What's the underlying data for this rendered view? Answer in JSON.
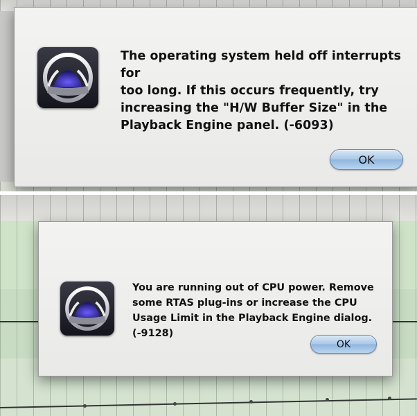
{
  "dialogs": [
    {
      "message": "The operating system held off interrupts for\ntoo long. If this occurs frequently, try\nincreasing the \"H/W Buffer Size\" in the\nPlayback Engine panel.  (-6093)",
      "ok_label": "OK",
      "icon": "app-logo-icon"
    },
    {
      "message": "You are running out of CPU power. Remove\nsome RTAS plug-ins or increase the CPU\nUsage Limit in the Playback Engine dialog.\n(-9128)",
      "ok_label": "OK",
      "icon": "app-logo-icon"
    }
  ],
  "colors": {
    "button_accent": "#a9c7e6",
    "dialog_bg": "#f0f0ef",
    "icon_blue": "#4a3fc8",
    "track_green": "#cfe3c9"
  }
}
